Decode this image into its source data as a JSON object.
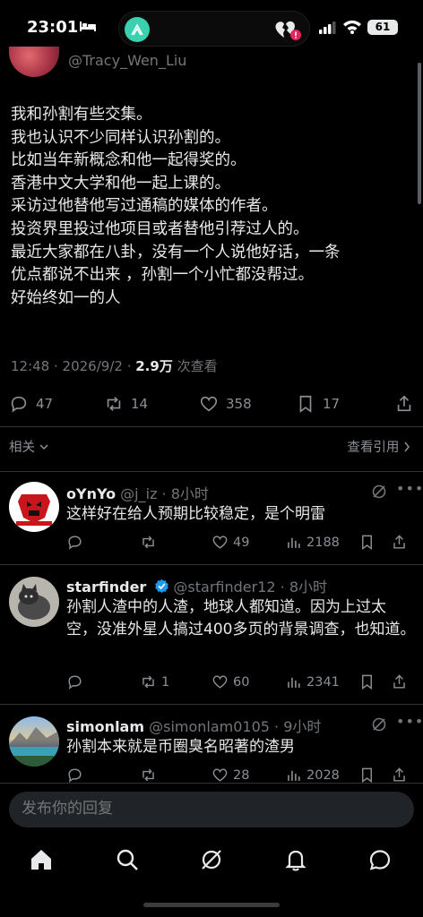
{
  "status_bar": {
    "time": "23:01",
    "battery": "61"
  },
  "top_author": {
    "handle": "@Tracy_Wen_Liu"
  },
  "post": {
    "lines": [
      "我和孙割有些交集。",
      "我也认识不少同样认识孙割的。",
      "比如当年新概念和他一起得奖的。",
      "香港中文大学和他一起上课的。",
      "采访过他替他写过通稿的媒体的作者。",
      "投资界里投过他项目或者替他引荐过人的。",
      "最近大家都在八卦，没有一个人说他好话，一条",
      "优点都说不出来 ，孙割一个小忙都没帮过。",
      "好始终如一的人"
    ],
    "time": "12:48",
    "date": "· 2026/9/2 ·",
    "views_count": "2.9万",
    "views_label": "次查看",
    "replies": "47",
    "reposts": "14",
    "likes": "358",
    "bookmarks": "17"
  },
  "filters": {
    "related": "相关",
    "view_quotes": "查看引用"
  },
  "replies": [
    {
      "name": "oYnYo",
      "handle": "@j_iz · 8小时",
      "text": "这样好在给人预期比较稳定，是个明雷",
      "replies": "",
      "reposts": "",
      "likes": "49",
      "views": "2188",
      "verified": false
    },
    {
      "name": "starfinder",
      "handle": "@starfinder12 · 8小时",
      "text": "孙割人渣中的人渣，地球人都知道。因为上过太空，没准外星人搞过400多页的背景调查，也知道。",
      "replies": "",
      "reposts": "1",
      "likes": "60",
      "views": "2341",
      "verified": true
    },
    {
      "name": "simonlam",
      "handle": "@simonlam0105 · 9小时",
      "text": "孙割本来就是币圈臭名昭著的渣男",
      "replies": "",
      "reposts": "",
      "likes": "28",
      "views": "2028",
      "verified": false
    }
  ],
  "compose": {
    "placeholder": "发布你的回复"
  },
  "colors": {
    "background": "#000000",
    "text": "#e7e9ea",
    "muted": "#71767b",
    "verified": "#1d9bf0"
  },
  "icons": [
    "reply-icon",
    "repost-icon",
    "like-icon",
    "bookmark-icon",
    "views-icon",
    "grok-icon",
    "more-icon",
    "home-icon",
    "search-icon",
    "notifications-icon",
    "messages-icon"
  ]
}
